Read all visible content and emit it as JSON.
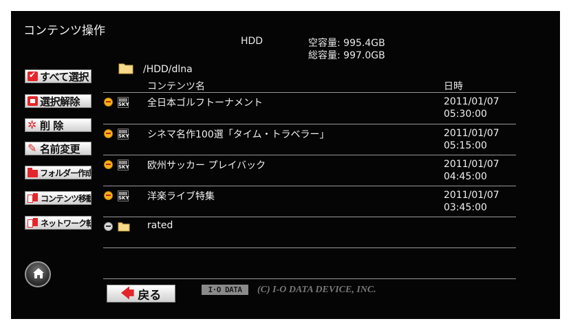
{
  "screen": {
    "title": "コンテンツ操作",
    "device": "HDD",
    "free_space": "空容量:  995.4GB",
    "total_space": "総容量:  997.0GB"
  },
  "sidebar": {
    "buttons": [
      {
        "label": "すべて選択",
        "icon": "checkbox-icon"
      },
      {
        "label": "選択解除",
        "icon": "uncheck-icon"
      },
      {
        "label": "削 除",
        "icon": "burst-icon"
      },
      {
        "label": "名前変更",
        "icon": "pencil-icon"
      },
      {
        "label": "フォルダー作成",
        "icon": "folder-icon"
      },
      {
        "label": "コンテンツ移動",
        "icon": "move-icon"
      },
      {
        "label": "ネットワーク転送",
        "icon": "transfer-icon"
      }
    ],
    "home_icon": "home-icon"
  },
  "content": {
    "path": "/HDD/dlna",
    "header_name": "コンテンツ名",
    "header_date": "日時",
    "rows": [
      {
        "name": "全日本ゴルフトーナメント",
        "date": "2011/01/07",
        "time": "05:30:00",
        "channel_logo": "SKY"
      },
      {
        "name": "シネマ名作100選「タイム・トラベラー」",
        "date": "2011/01/07",
        "time": "05:15:00",
        "channel_logo": "SKY"
      },
      {
        "name": "欧州サッカー プレイバック",
        "date": "2011/01/07",
        "time": "04:45:00",
        "channel_logo": "SKY"
      },
      {
        "name": "洋楽ライブ特集",
        "date": "2011/01/07",
        "time": "03:45:00",
        "channel_logo": "SKY"
      },
      {
        "name": "rated",
        "type": "folder"
      }
    ]
  },
  "footer": {
    "back_label": "戻る",
    "brand": "I·O DATA",
    "copyright": "(C) I-O DATA DEVICE, INC."
  },
  "colors": {
    "screen_bg": "#050505",
    "accent_red": "#e3262b",
    "record_badge": "#f2b21b",
    "folder": "#f7d98a",
    "divider": "#9a9a9a"
  }
}
